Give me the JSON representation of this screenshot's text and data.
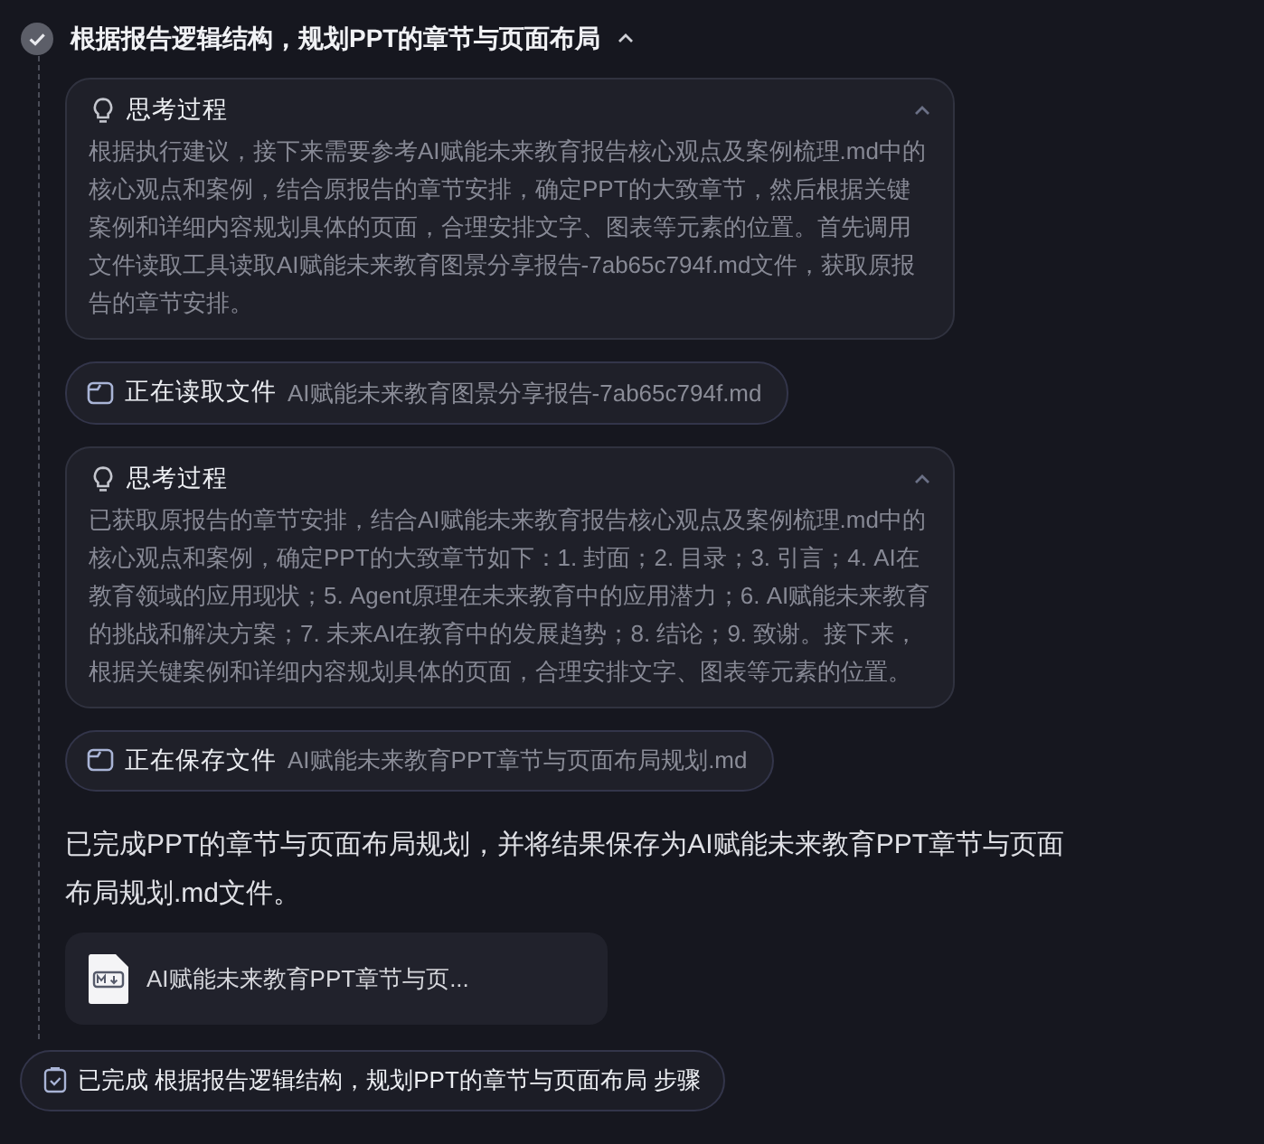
{
  "step": {
    "title": "根据报告逻辑结构，规划PPT的章节与页面布局",
    "done": true,
    "expanded": true,
    "items": [
      {
        "kind": "thought",
        "title": "思考过程",
        "expanded": true,
        "text": "根据执行建议，接下来需要参考AI赋能未来教育报告核心观点及案例梳理.md中的核心观点和案例，结合原报告的章节安排，确定PPT的大致章节，然后根据关键案例和详细内容规划具体的页面，合理安排文字、图表等元素的位置。首先调用文件读取工具读取AI赋能未来教育图景分享报告-7ab65c794f.md文件，获取原报告的章节安排。"
      },
      {
        "kind": "file",
        "action": "正在读取文件",
        "filename": "AI赋能未来教育图景分享报告-7ab65c794f.md"
      },
      {
        "kind": "thought",
        "title": "思考过程",
        "expanded": true,
        "text": "已获取原报告的章节安排，结合AI赋能未来教育报告核心观点及案例梳理.md中的核心观点和案例，确定PPT的大致章节如下：1. 封面；2. 目录；3. 引言；4. AI在教育领域的应用现状；5. Agent原理在未来教育中的应用潜力；6. AI赋能未来教育的挑战和解决方案；7. 未来AI在教育中的发展趋势；8. 结论；9. 致谢。接下来，根据关键案例和详细内容规划具体的页面，合理安排文字、图表等元素的位置。"
      },
      {
        "kind": "file",
        "action": "正在保存文件",
        "filename": "AI赋能未来教育PPT章节与页面布局规划.md"
      },
      {
        "kind": "message",
        "text": "已完成PPT的章节与页面布局规划，并将结果保存为AI赋能未来教育PPT章节与页面布局规划.md文件。"
      },
      {
        "kind": "attachment",
        "filename": "AI赋能未来教育PPT章节与页..."
      }
    ]
  },
  "status": {
    "text": "已完成 根据报告逻辑结构，规划PPT的章节与页面布局 步骤"
  }
}
